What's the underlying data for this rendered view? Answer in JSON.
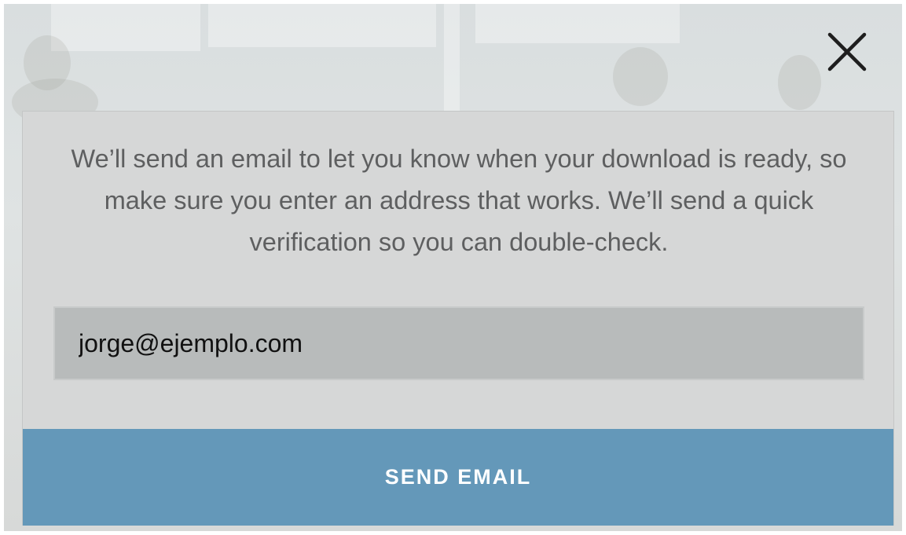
{
  "dialog": {
    "message": "We’ll send an email to let you know when your download is ready, so make sure you enter an address that works. We’ll send a quick verification so you can double-check.",
    "email_value": "jorge@ejemplo.com",
    "send_label": "SEND EMAIL",
    "close_icon": "close-icon"
  },
  "colors": {
    "button_background": "#6498b9",
    "modal_background": "#d6d7d7",
    "input_background": "#b8bbbb"
  }
}
